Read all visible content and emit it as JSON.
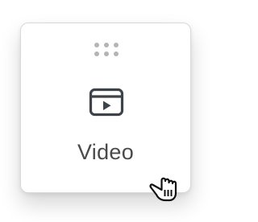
{
  "block": {
    "label": "Video",
    "icon": "video-icon",
    "handle_icon": "drag-handle-icon"
  },
  "cursor": {
    "icon": "grab-hand-cursor-icon"
  },
  "colors": {
    "border": "#d9d9d9",
    "icon": "#3d4349",
    "handle": "#b4b4b4",
    "text": "#4a4a4a"
  }
}
